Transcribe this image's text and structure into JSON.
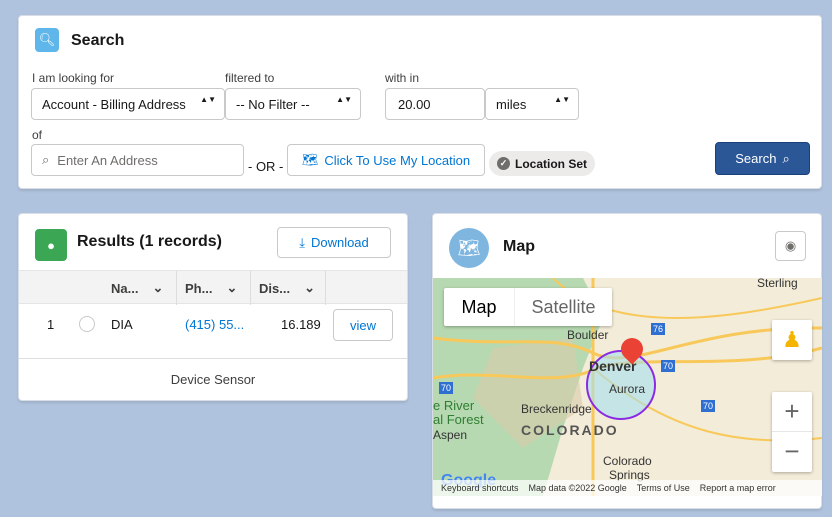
{
  "search": {
    "title": "Search",
    "looking_for_label": "I am looking for",
    "looking_for_value": "Account - Billing Address",
    "filtered_label": "filtered to",
    "filter_value": "-- No Filter --",
    "within_label": "with in",
    "distance_value": "20.00",
    "unit_value": "miles",
    "of_label": "of",
    "address_placeholder": "Enter An Address",
    "or_label": "- OR -",
    "location_button": "Click To Use My Location",
    "location_status": "Location Set",
    "search_button": "Search"
  },
  "results": {
    "title": "Results (1 records)",
    "download_button": "Download",
    "columns": [
      "Na...",
      "Ph...",
      "Dis..."
    ],
    "rows": [
      {
        "index": "1",
        "name": "DIA",
        "phone": "(415) 55...",
        "distance": "16.189",
        "action": "view"
      }
    ],
    "footer": "Device Sensor"
  },
  "map": {
    "title": "Map",
    "tabs": [
      "Map",
      "Satellite"
    ],
    "labels": {
      "sterling": "Sterling",
      "boulder": "Boulder",
      "denver": "Denver",
      "aurora": "Aurora",
      "river": "e River",
      "forest": "al Forest",
      "aspen": "Aspen",
      "breckenridge": "Breckenridge",
      "colorado": "COLORADO",
      "springs1": "Colorado",
      "springs2": "Springs",
      "i76": "76",
      "i70a": "70",
      "i70b": "70",
      "i70c": "70"
    },
    "footer": {
      "shortcuts": "Keyboard shortcuts",
      "data": "Map data ©2022 Google",
      "terms": "Terms of Use",
      "report": "Report a map error"
    },
    "logo": "Google"
  },
  "colors": {
    "accent": "#0176d3",
    "search_button": "#2b5797",
    "results_icon": "#3ba755",
    "map_icon": "#7fb6e0",
    "radius": "#8a2be2"
  }
}
